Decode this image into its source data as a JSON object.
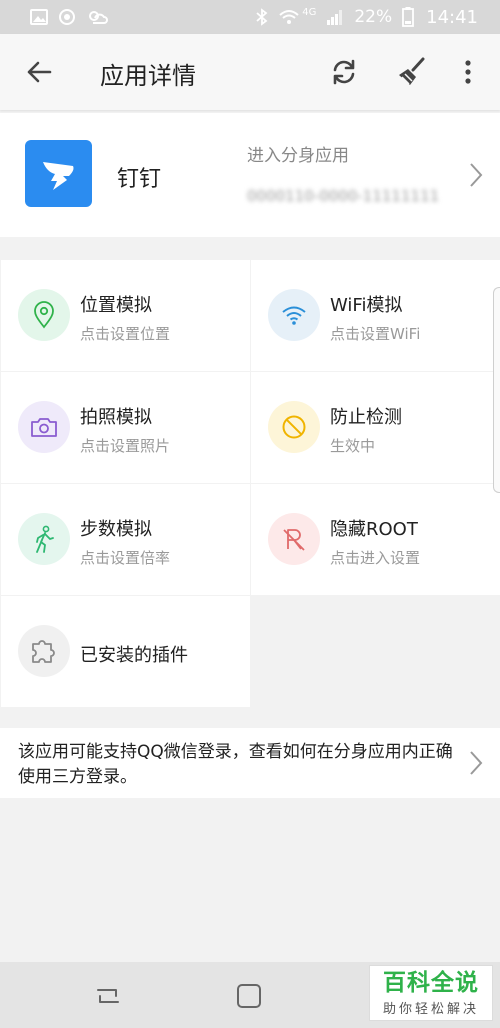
{
  "status_bar": {
    "network": "4G",
    "battery": "22%",
    "time": "14:41"
  },
  "app_bar": {
    "title": "应用详情",
    "icons": [
      "arrow-back-icon",
      "sync-icon",
      "broom-icon",
      "more-vert-icon"
    ]
  },
  "app_info": {
    "name": "钉钉",
    "enter_label": "进入分身应用",
    "device_id": "0000110-0000-11111111"
  },
  "features": [
    {
      "title": "位置模拟",
      "subtitle": "点击设置位置",
      "icon": "location-pin-icon",
      "bg": "#e3f6ea",
      "fg": "#2fb24a"
    },
    {
      "title": "WiFi模拟",
      "subtitle": "点击设置WiFi",
      "icon": "wifi-icon",
      "bg": "#e6f0f8",
      "fg": "#2a8fd8"
    },
    {
      "title": "拍照模拟",
      "subtitle": "点击设置照片",
      "icon": "camera-icon",
      "bg": "#efeafa",
      "fg": "#8a5cd0"
    },
    {
      "title": "防止检测",
      "subtitle": "生效中",
      "icon": "block-icon",
      "bg": "#fdf5d8",
      "fg": "#f0b400"
    },
    {
      "title": "步数模拟",
      "subtitle": "点击设置倍率",
      "icon": "walking-icon",
      "bg": "#e4f6ee",
      "fg": "#2eb872"
    },
    {
      "title": "隐藏ROOT",
      "subtitle": "点击进入设置",
      "icon": "root-crossed-icon",
      "bg": "#fde9e9",
      "fg": "#e06a6a"
    },
    {
      "title": "已安装的插件",
      "subtitle": "",
      "icon": "puzzle-icon",
      "bg": "#f0f0f0",
      "fg": "#8a8a8a"
    }
  ],
  "login_tip": {
    "text": "该应用可能支持QQ微信登录，查看如何在分身应用内正确使用三方登录。"
  },
  "watermark": {
    "title": "百科全说",
    "subtitle": "助你轻松解决"
  }
}
